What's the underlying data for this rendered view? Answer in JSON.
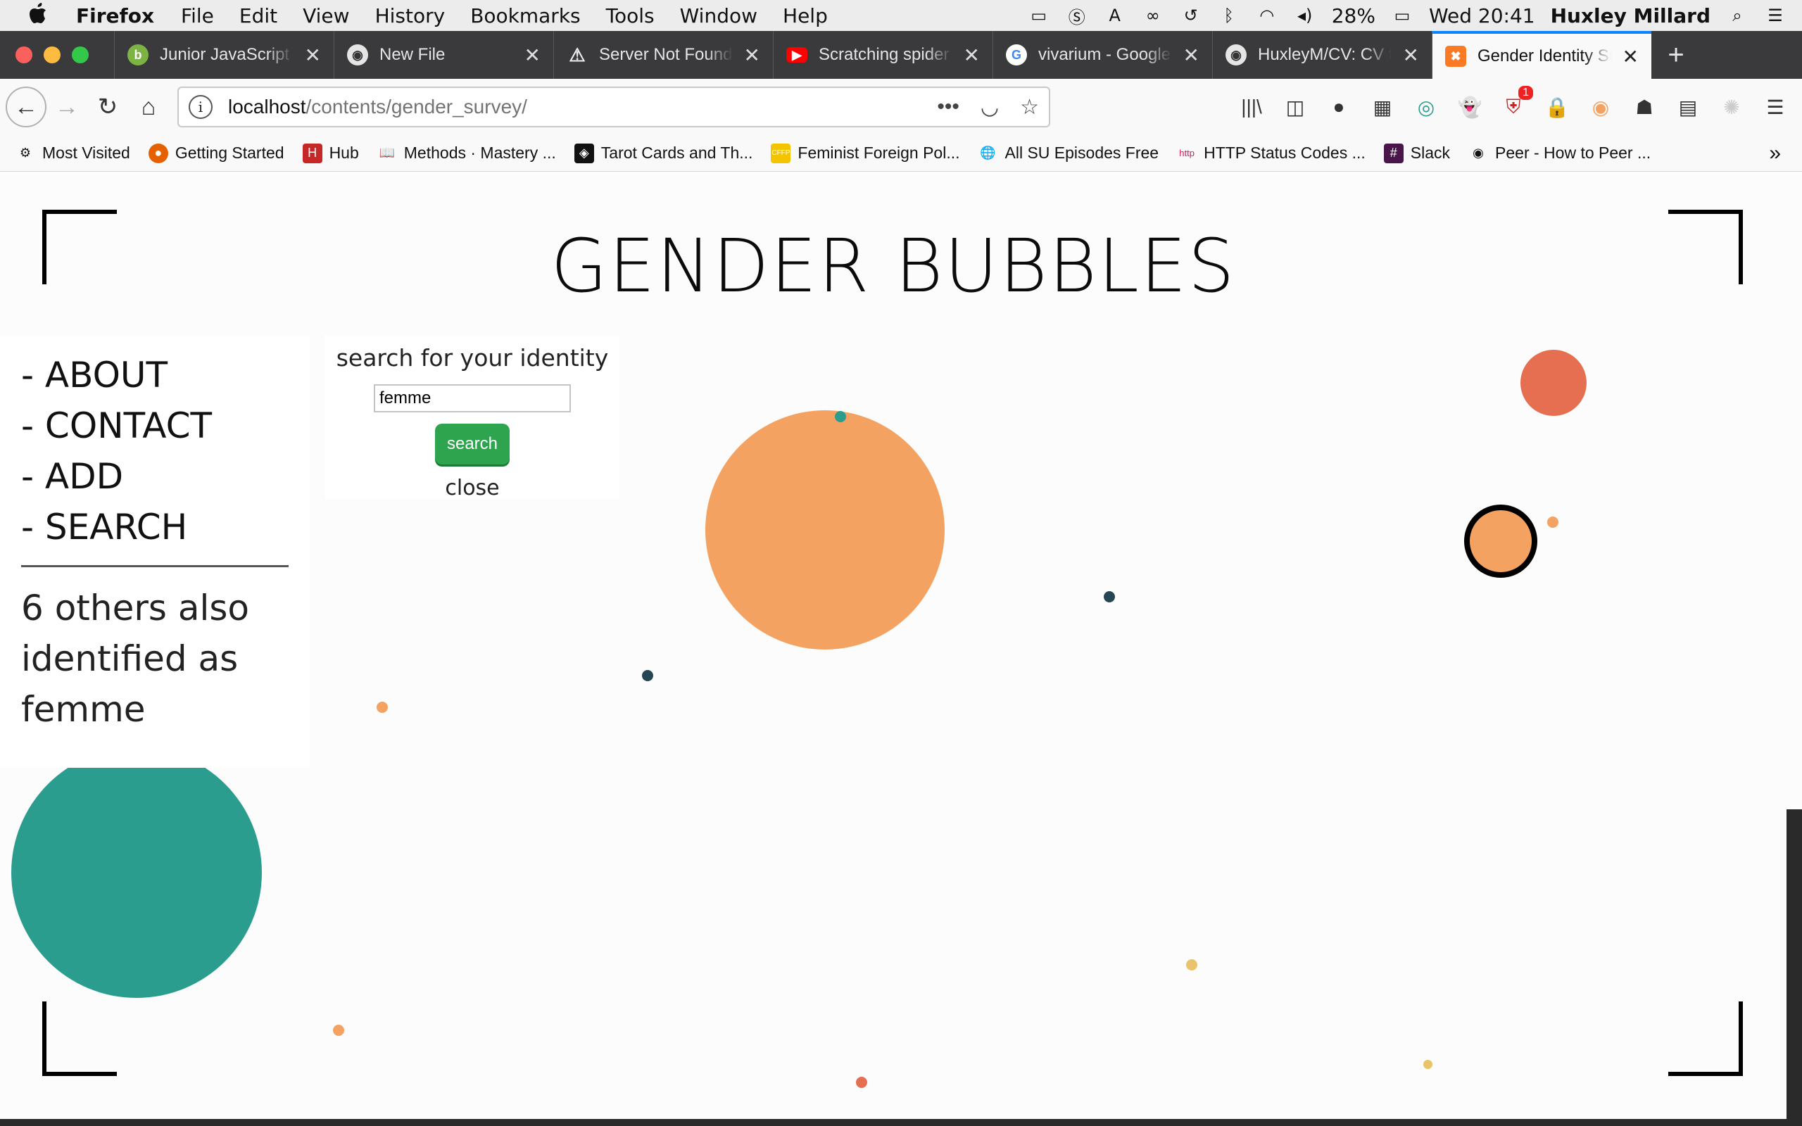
{
  "menubar": {
    "app": "Firefox",
    "items": [
      "File",
      "Edit",
      "View",
      "History",
      "Bookmarks",
      "Tools",
      "Window",
      "Help"
    ],
    "battery": "28%",
    "clock": "Wed 20:41",
    "user": "Huxley Millard"
  },
  "tabs": [
    {
      "title": "Junior JavaScript D",
      "favicon": "badge-icon",
      "color": "#7cb342"
    },
    {
      "title": "New File",
      "favicon": "github-icon",
      "color": "#e5e5e5"
    },
    {
      "title": "Server Not Found",
      "favicon": "warning-icon",
      "color": "#e5e5e5"
    },
    {
      "title": "Scratching spider",
      "favicon": "youtube-icon",
      "color": "#ff0000"
    },
    {
      "title": "vivarium - Google",
      "favicon": "google-icon",
      "color": "#4285f4"
    },
    {
      "title": "HuxleyM/CV: CV to",
      "favicon": "github-icon",
      "color": "#e5e5e5"
    },
    {
      "title": "Gender Identity Su",
      "favicon": "xampp-icon",
      "color": "#fb7a24",
      "active": true
    }
  ],
  "url": {
    "host": "localhost",
    "path": "/contents/gender_survey/"
  },
  "toolbar_badge": "1",
  "bookmarks": [
    {
      "label": "Most Visited",
      "icon": "gear-icon",
      "color": "#555"
    },
    {
      "label": "Getting Started",
      "icon": "firefox-icon",
      "color": "#e66000"
    },
    {
      "label": "Hub",
      "icon": "hub-icon",
      "color": "#c62828"
    },
    {
      "label": "Methods · Mastery ...",
      "icon": "book-icon",
      "color": "#555"
    },
    {
      "label": "Tarot Cards and Th...",
      "icon": "tarot-icon",
      "color": "#111"
    },
    {
      "label": "Feminist Foreign Pol...",
      "icon": "cffp-icon",
      "color": "#f2c500"
    },
    {
      "label": "All SU Episodes Free",
      "icon": "globe-icon",
      "color": "#3a7bd5"
    },
    {
      "label": "HTTP Status Codes ...",
      "icon": "http-icon",
      "color": "#e0115f"
    },
    {
      "label": "Slack",
      "icon": "slack-icon",
      "color": "#4a154b"
    },
    {
      "label": "Peer - How to Peer ...",
      "icon": "github-icon",
      "color": "#111"
    }
  ],
  "page": {
    "title": "GENDER BUBBLES",
    "nav": [
      "- ABOUT",
      "- CONTACT",
      "- ADD",
      "- SEARCH"
    ],
    "result_text": "6 others also identified as femme",
    "search": {
      "label": "search for your identity",
      "value": "femme",
      "button": "search",
      "close": "close"
    }
  },
  "colors": {
    "orange": "#f4a261",
    "teal": "#2a9d8f",
    "red": "#e76f51",
    "navy": "#264653",
    "yellow": "#e9c46a"
  }
}
